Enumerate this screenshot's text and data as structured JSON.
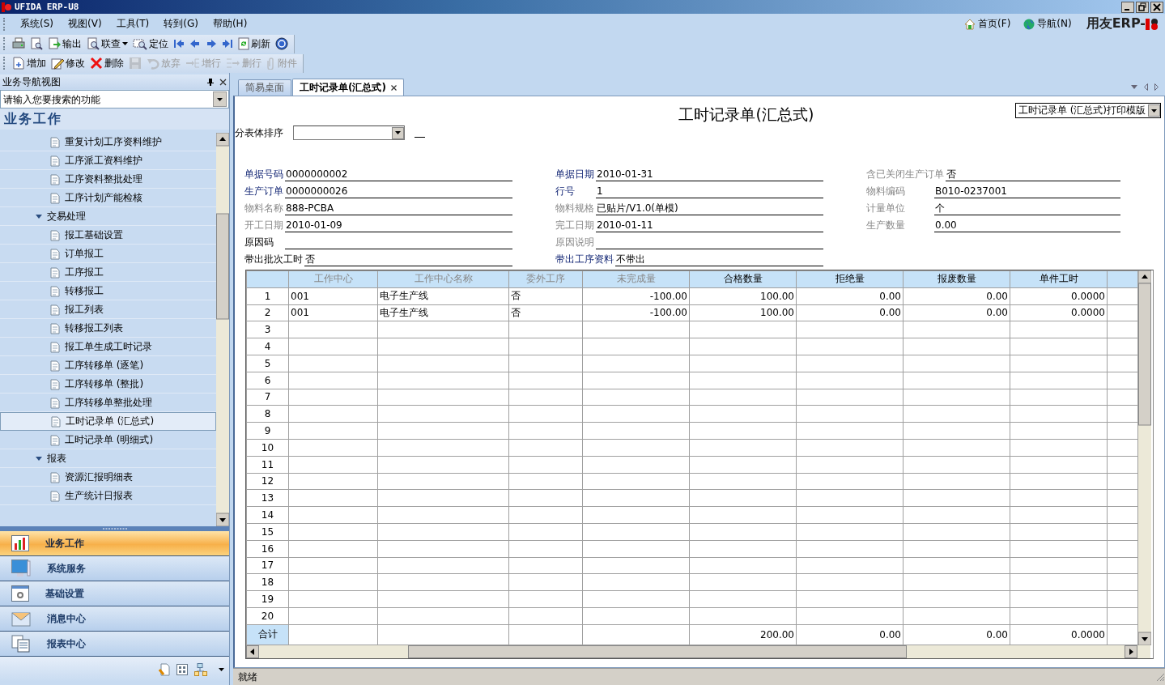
{
  "window": {
    "title": "UFIDA ERP-U8"
  },
  "menu": [
    {
      "label": "系统(S)"
    },
    {
      "label": "视图(V)"
    },
    {
      "label": "工具(T)"
    },
    {
      "label": "转到(G)"
    },
    {
      "label": "帮助(H)"
    }
  ],
  "quick_links": [
    {
      "label": "首页(F)"
    },
    {
      "label": "导航(N)"
    }
  ],
  "brand": "用友ERP-",
  "toolbars": [
    [
      {
        "disabled": false
      },
      {
        "disabled": false
      },
      {
        "label": "输出",
        "disabled": false
      },
      {
        "label": "联查",
        "disabled": false,
        "dropdown": true
      },
      {
        "label": "定位",
        "disabled": false
      },
      {
        "disabled": false
      },
      {
        "disabled": false
      },
      {
        "disabled": false
      },
      {
        "disabled": false
      },
      {
        "label": "刷新",
        "disabled": false
      },
      {
        "disabled": false
      }
    ],
    [
      {
        "label": "增加",
        "disabled": false
      },
      {
        "label": "修改",
        "disabled": false
      },
      {
        "label": "删除",
        "disabled": false
      },
      {
        "disabled": true
      },
      {
        "label": "放弃",
        "disabled": true
      },
      {
        "label": "增行",
        "disabled": true
      },
      {
        "label": "删行",
        "disabled": true
      },
      {
        "label": "附件",
        "disabled": true
      }
    ]
  ],
  "nav": {
    "title": "业务导航视图",
    "search": {
      "placeholder": "请输入您要搜索的功能"
    },
    "heading": "业务工作",
    "tree": [
      {
        "kind": "continued",
        "children": [
          {
            "label": "重复计划工序资料维护",
            "selected": false
          },
          {
            "label": "工序派工资料维护",
            "selected": false
          },
          {
            "label": "工序资料整批处理",
            "selected": false
          },
          {
            "label": "工序计划产能检核",
            "selected": false
          }
        ]
      },
      {
        "kind": "group",
        "label": "交易处理",
        "expanded": true,
        "children": [
          {
            "label": "报工基础设置",
            "selected": false
          },
          {
            "label": "订单报工",
            "selected": false
          },
          {
            "label": "工序报工",
            "selected": false
          },
          {
            "label": "转移报工",
            "selected": false
          },
          {
            "label": "报工列表",
            "selected": false
          },
          {
            "label": "转移报工列表",
            "selected": false
          },
          {
            "label": "报工单生成工时记录",
            "selected": false
          },
          {
            "label": "工序转移单 (逐笔)",
            "selected": false
          },
          {
            "label": "工序转移单 (整批)",
            "selected": false
          },
          {
            "label": "工序转移单整批处理",
            "selected": false
          },
          {
            "label": "工时记录单 (汇总式)",
            "selected": true
          },
          {
            "label": "工时记录单 (明细式)",
            "selected": false
          }
        ]
      },
      {
        "kind": "group",
        "label": "报表",
        "expanded": true,
        "children": [
          {
            "label": "资源汇报明细表",
            "selected": false
          },
          {
            "label": "生产统计日报表",
            "selected": false
          }
        ]
      }
    ],
    "modules": [
      {
        "label": "业务工作",
        "selected": true
      },
      {
        "label": "系统服务",
        "selected": false
      },
      {
        "label": "基础设置",
        "selected": false
      },
      {
        "label": "消息中心",
        "selected": false
      },
      {
        "label": "报表中心",
        "selected": false
      }
    ]
  },
  "tabs": [
    {
      "label": "简易桌面",
      "selected": false,
      "closable": false
    },
    {
      "label": "工时记录单(汇总式)",
      "selected": true,
      "closable": true
    }
  ],
  "document": {
    "title": "工时记录单(汇总式)",
    "print_template": "工时记录单 (汇总式)打印模版",
    "sort_label": "分表体排序",
    "fields": [
      [
        {
          "label": "单据号码",
          "value": "0000000002",
          "kind": "required"
        },
        {
          "label": "单据日期",
          "value": "2010-01-31",
          "kind": "required"
        },
        {
          "label": "含已关闭生产订单",
          "value": "否",
          "kind": "disabled"
        }
      ],
      [
        {
          "label": "生产订单",
          "value": "0000000026",
          "kind": "required"
        },
        {
          "label": "行号",
          "value": "1",
          "kind": "required"
        },
        {
          "label": "物料编码",
          "value": "B010-0237001",
          "kind": "disabled"
        }
      ],
      [
        {
          "label": "物料名称",
          "value": "888-PCBA",
          "kind": "disabled"
        },
        {
          "label": "物料规格",
          "value": "已贴片/V1.0(单模)",
          "kind": "disabled"
        },
        {
          "label": "计量单位",
          "value": "个",
          "kind": "disabled"
        }
      ],
      [
        {
          "label": "开工日期",
          "value": "2010-01-09",
          "kind": "disabled"
        },
        {
          "label": "完工日期",
          "value": "2010-01-11",
          "kind": "disabled"
        },
        {
          "label": "生产数量",
          "value": "0.00",
          "kind": "disabled"
        }
      ],
      [
        {
          "label": "原因码",
          "kind": "normal"
        },
        {
          "label": "原因说明",
          "kind": "disabled"
        }
      ],
      [
        {
          "label": "带出批次工时",
          "value": "否",
          "kind": "normal"
        },
        {
          "label": "带出工序资料",
          "value": "不带出",
          "kind": "required"
        }
      ]
    ],
    "grid": {
      "columns": [
        {
          "label": "工作中心",
          "disabled": true,
          "kind": "text"
        },
        {
          "label": "工作中心名称",
          "disabled": true,
          "kind": "text"
        },
        {
          "label": "委外工序",
          "disabled": true,
          "kind": "text"
        },
        {
          "label": "未完成量",
          "disabled": true,
          "kind": "number"
        },
        {
          "label": "合格数量",
          "disabled": false,
          "kind": "number"
        },
        {
          "label": "拒绝量",
          "disabled": false,
          "kind": "number"
        },
        {
          "label": "报废数量",
          "disabled": false,
          "kind": "number"
        },
        {
          "label": "单件工时",
          "disabled": false,
          "kind": "number"
        }
      ],
      "rows": [
        {
          "no": "1",
          "cells": [
            "001",
            "电子生产线",
            "否",
            "-100.00",
            "100.00",
            "0.00",
            "0.00",
            "0.0000"
          ]
        },
        {
          "no": "2",
          "cells": [
            "001",
            "电子生产线",
            "否",
            "-100.00",
            "100.00",
            "0.00",
            "0.00",
            "0.0000"
          ]
        },
        {
          "no": "3"
        },
        {
          "no": "4"
        },
        {
          "no": "5"
        },
        {
          "no": "6"
        },
        {
          "no": "7"
        },
        {
          "no": "8"
        },
        {
          "no": "9"
        },
        {
          "no": "10"
        },
        {
          "no": "11"
        },
        {
          "no": "12"
        },
        {
          "no": "13"
        },
        {
          "no": "14"
        },
        {
          "no": "15"
        },
        {
          "no": "16"
        },
        {
          "no": "17"
        },
        {
          "no": "18"
        },
        {
          "no": "19"
        },
        {
          "no": "20"
        }
      ],
      "total": {
        "label": "合计",
        "cells": [
          null,
          null,
          null,
          null,
          "200.00",
          "0.00",
          "0.00",
          "0.0000"
        ]
      }
    }
  },
  "status_bar": "就绪"
}
